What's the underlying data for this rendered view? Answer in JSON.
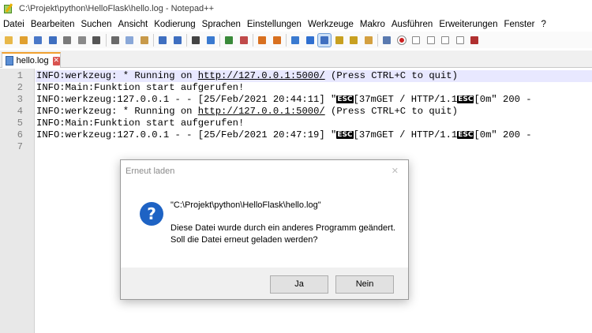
{
  "window": {
    "title": "C:\\Projekt\\python\\HelloFlask\\hello.log - Notepad++"
  },
  "menu": {
    "items": [
      "Datei",
      "Bearbeiten",
      "Suchen",
      "Ansicht",
      "Kodierung",
      "Sprachen",
      "Einstellungen",
      "Werkzeuge",
      "Makro",
      "Ausführen",
      "Erweiterungen",
      "Fenster",
      "?"
    ]
  },
  "toolbar": {
    "icons": [
      "new-file-icon",
      "open-file-icon",
      "save-icon",
      "save-all-icon",
      "close-icon",
      "close-all-icon",
      "print-icon",
      "cut-icon",
      "copy-icon",
      "paste-icon",
      "undo-icon",
      "redo-icon",
      "find-icon",
      "replace-icon",
      "zoom-in-icon",
      "zoom-out-icon",
      "sync-vertical-icon",
      "sync-horizontal-icon",
      "word-wrap-icon",
      "show-all-chars-icon",
      "indent-guide-icon",
      "doc-map-icon",
      "function-list-icon",
      "folder-workspace-icon",
      "monitor-icon",
      "record-macro-icon",
      "stop-record-icon",
      "play-macro-icon",
      "run-macro-multiple-icon",
      "save-macro-icon",
      "spell-check-icon"
    ],
    "active_index": 20
  },
  "tab": {
    "label": "hello.log",
    "close": "✕"
  },
  "editor": {
    "line_numbers": [
      "1",
      "2",
      "3",
      "4",
      "5",
      "6",
      "7"
    ],
    "current_line": 1,
    "esc_label": "ESC",
    "lines": [
      {
        "a": "INFO:werkzeug: * Running on ",
        "url": "http://127.0.0.1:5000/",
        "b": " (Press CTRL+C to quit)"
      },
      {
        "a": "INFO:Main:Funktion start aufgerufen!"
      },
      {
        "a": "INFO:werkzeug:127.0.0.1 - - [25/Feb/2021 20:44:11] \"",
        "mid": "[37mGET / HTTP/1.1",
        "end": "[0m\" 200 -"
      },
      {
        "a": "INFO:werkzeug: * Running on ",
        "url": "http://127.0.0.1:5000/",
        "b": " (Press CTRL+C to quit)"
      },
      {
        "a": "INFO:Main:Funktion start aufgerufen!"
      },
      {
        "a": "INFO:werkzeug:127.0.0.1 - - [25/Feb/2021 20:47:19] \"",
        "mid": "[37mGET / HTTP/1.1",
        "end": "[0m\" 200 -"
      },
      {
        "a": ""
      }
    ]
  },
  "dialog": {
    "title": "Erneut laden",
    "close": "✕",
    "path": "\"C:\\Projekt\\python\\HelloFlask\\hello.log\"",
    "message_line1": "Diese Datei wurde durch ein anderes Programm geändert.",
    "message_line2": "Soll die Datei erneut geladen werden?",
    "yes_label": "Ja",
    "no_label": "Nein",
    "icon": "?"
  },
  "colors": {
    "accent_tab": "#f0a030",
    "current_line": "#e8e8ff",
    "question_icon": "#1e63c4"
  }
}
